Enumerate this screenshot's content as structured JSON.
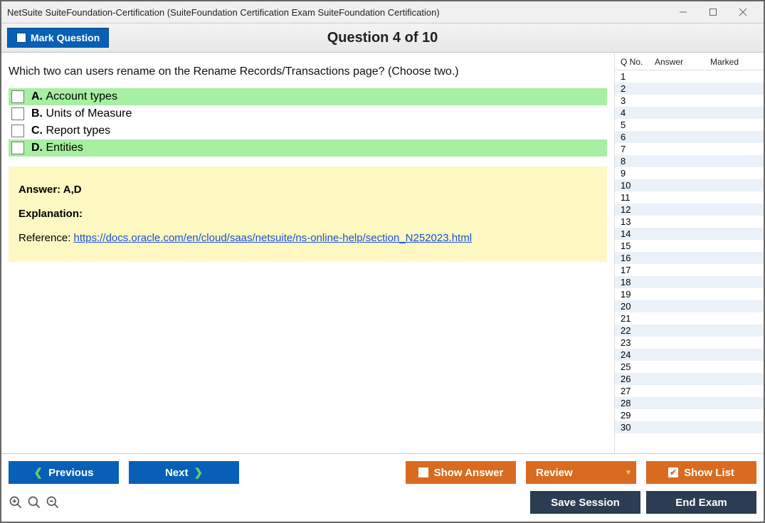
{
  "window": {
    "title": "NetSuite SuiteFoundation-Certification (SuiteFoundation Certification Exam SuiteFoundation Certification)"
  },
  "header": {
    "mark_label": "Mark Question",
    "question_title": "Question 4 of 10"
  },
  "question": {
    "text": "Which two can users rename on the Rename Records/Transactions page? (Choose two.)",
    "choices": [
      {
        "letter": "A.",
        "text": "Account types",
        "correct": true
      },
      {
        "letter": "B.",
        "text": "Units of Measure",
        "correct": false
      },
      {
        "letter": "C.",
        "text": "Report types",
        "correct": false
      },
      {
        "letter": "D.",
        "text": "Entities",
        "correct": true
      }
    ]
  },
  "explanation": {
    "answer_label": "Answer: A,D",
    "explanation_label": "Explanation:",
    "reference_prefix": "Reference: ",
    "reference_link": "https://docs.oracle.com/en/cloud/saas/netsuite/ns-online-help/section_N252023.html"
  },
  "sidebar": {
    "headers": {
      "qno": "Q No.",
      "answer": "Answer",
      "marked": "Marked"
    },
    "row_count": 30
  },
  "footer": {
    "previous": "Previous",
    "next": "Next",
    "show_answer": "Show Answer",
    "review": "Review",
    "show_list": "Show List",
    "save_session": "Save Session",
    "end_exam": "End Exam"
  }
}
